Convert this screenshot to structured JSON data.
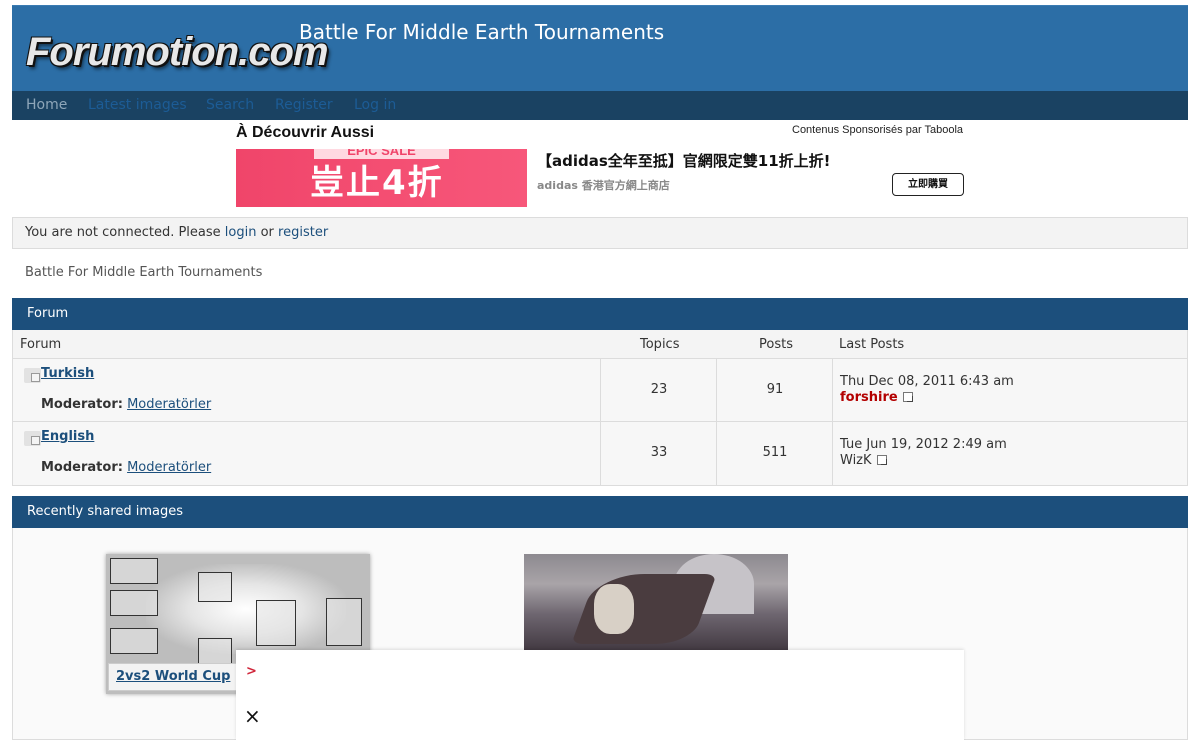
{
  "header": {
    "logo_text": "Forumotion.com",
    "site_title": "Battle For Middle Earth Tournaments"
  },
  "nav": {
    "items": [
      "Home",
      "Latest images",
      "Search",
      "Register",
      "Log in"
    ]
  },
  "sponsored": {
    "heading": "À Découvrir Aussi",
    "by": "Contenus Sponsorisés par Taboola",
    "ad_image_tag": "EPIC SALE",
    "ad_image_text": "豈止4折",
    "ad_title": "【adidas全年至抵】官網限定雙11折上折!",
    "ad_source": "adidas 香港官方網上商店",
    "ad_cta": "立即購買"
  },
  "connect_bar": {
    "prefix": "You are not connected. Please ",
    "login": "login",
    "middle": " or ",
    "register": "register"
  },
  "breadcrumb": "Battle For Middle Earth Tournaments",
  "forum": {
    "block_title": "Forum",
    "columns": {
      "forum": "Forum",
      "topics": "Topics",
      "posts": "Posts",
      "last_posts": "Last Posts"
    },
    "moderator_label": "Moderator:",
    "rows": [
      {
        "name": "Turkish",
        "moderator": "Moderatörler",
        "topics": "23",
        "posts": "91",
        "last_date": "Thu Dec 08, 2011 6:43 am",
        "last_user": "forshire"
      },
      {
        "name": "English",
        "moderator": "Moderatörler",
        "topics": "33",
        "posts": "511",
        "last_date": "Tue Jun 19, 2012 2:49 am",
        "last_user": "WizK"
      }
    ]
  },
  "recent_images": {
    "block_title": "Recently shared images",
    "caption_1": "2vs2 World Cup"
  },
  "overlay": {
    "arrow": ">",
    "close": "×"
  },
  "colors": {
    "header_bg": "#2c6ea6",
    "navbar_bg": "#1a4262",
    "block_head_bg": "#1c4f7c",
    "link": "#1c4f7c",
    "user_red": "#b30000"
  },
  "icons": {
    "forum_row": "folder-icon",
    "last_post": "goto-post-icon",
    "overlay_close": "close-icon"
  }
}
